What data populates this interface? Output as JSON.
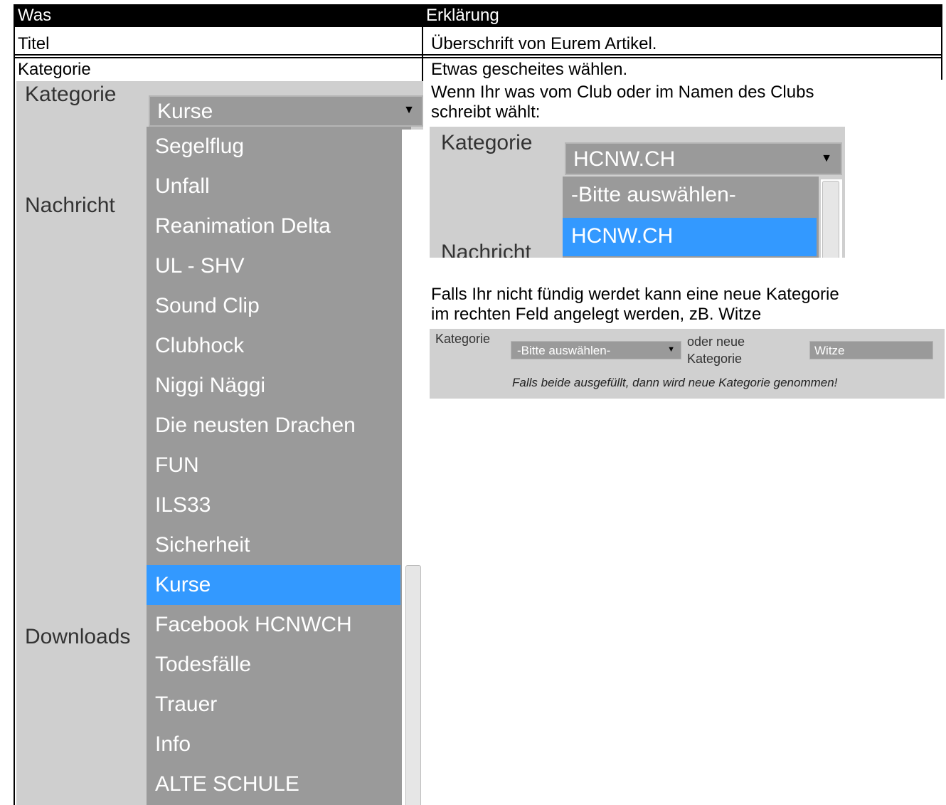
{
  "header": {
    "col1": "Was",
    "col2": "Erklärung"
  },
  "rows": {
    "titel": {
      "was": "Titel",
      "erklaerung": "Überschrift von Eurem Artikel."
    },
    "kategorie": {
      "was": "Kategorie",
      "line1": "Etwas gescheites wählen.",
      "line2": "Wenn Ihr was vom Club oder im Namen des Clubs",
      "line3": "schreibt wählt:",
      "line4": "Falls Ihr nicht fündig werdet kann eine neue Kategorie",
      "line5": "im rechten Feld angelegt werden, zB. Witze"
    }
  },
  "screenshot_dropdown": {
    "label_kategorie": "Kategorie",
    "label_nachricht": "Nachricht",
    "label_downloads": "Downloads",
    "selected": "Kurse",
    "options": [
      "Segelflug",
      "Unfall",
      "Reanimation Delta",
      "UL - SHV",
      "Sound Clip",
      "Clubhock",
      "Niggi Näggi",
      "Die neusten Drachen",
      "FUN",
      "ILS33",
      "Sicherheit",
      "Kurse",
      "Facebook HCNWCH",
      "Todesfälle",
      "Trauer",
      "Info",
      "ALTE SCHULE"
    ],
    "highlighted": "Kurse",
    "highlight_color": "#3399ff"
  },
  "screenshot_club": {
    "label_kategorie": "Kategorie",
    "label_nachricht": "Nachricht",
    "selected": "HCNW.CH",
    "options": [
      "-Bitte auswählen-",
      "HCNW.CH"
    ],
    "highlighted": "HCNW.CH"
  },
  "screenshot_new": {
    "label_kategorie": "Kategorie",
    "select_value": "-Bitte auswählen-",
    "label_oder_neue": "oder neue",
    "label_kategorie2": "Kategorie",
    "input_value": "Witze",
    "note": "Falls beide ausgefüllt, dann wird neue Kategorie genommen!"
  }
}
